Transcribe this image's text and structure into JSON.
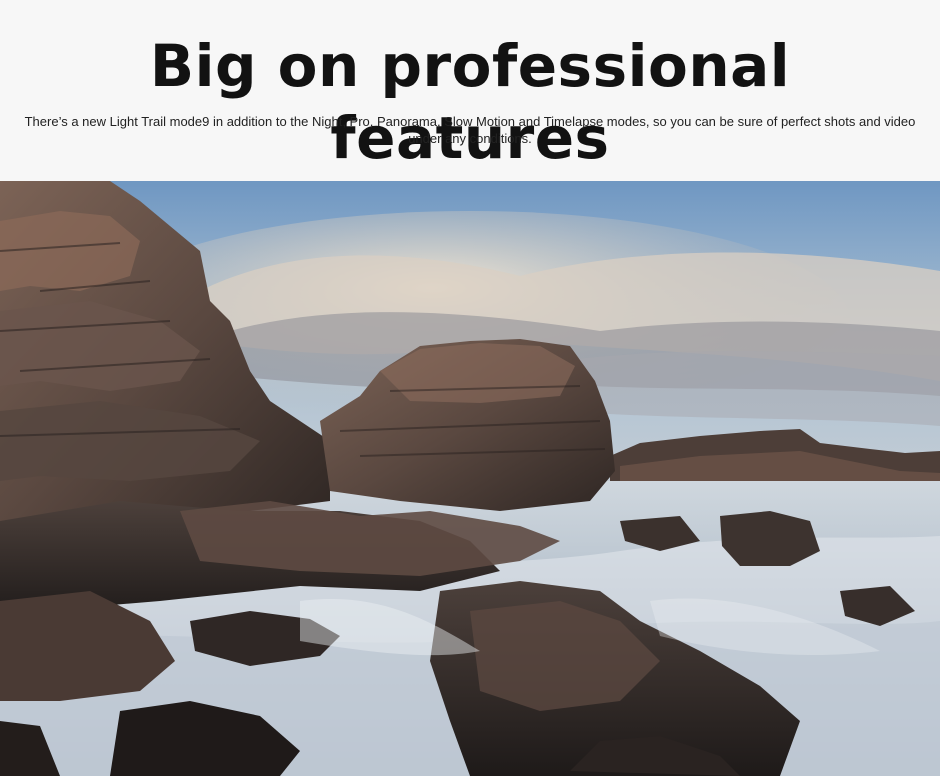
{
  "header": {
    "title": "Big on professional features",
    "description": "There’s a new Light Trail mode9 in addition to the Night, Pro, Panorama, Slow Motion and Timelapse modes, so you can be sure of perfect shots and video under any conditions."
  },
  "photo": {
    "subject": "rocky-coastline-long-exposure",
    "colors": {
      "sky_top": "#7fa3c8",
      "cloud": "#e9dccb",
      "rock_dark": "#3a2f2b",
      "rock_warm": "#8a5a44",
      "water": "#c9d3dc"
    }
  }
}
